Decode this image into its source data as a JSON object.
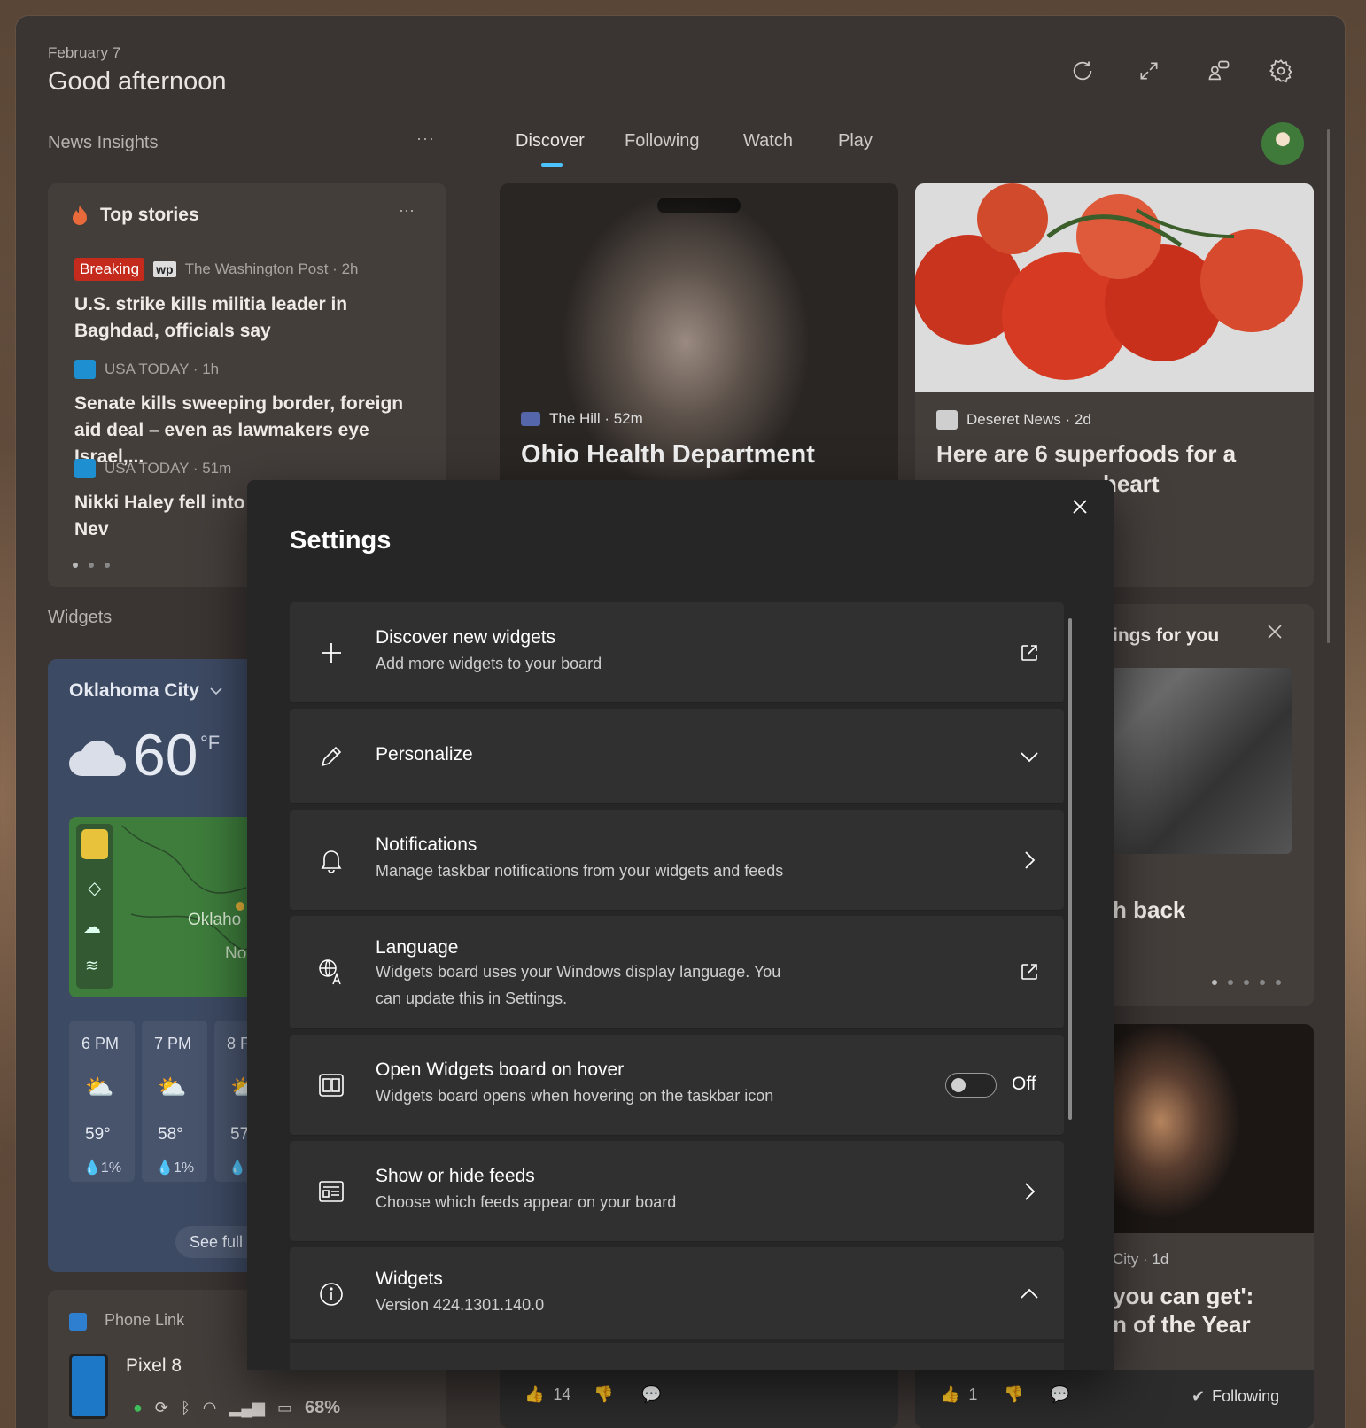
{
  "header": {
    "date": "February 7",
    "greeting": "Good afternoon"
  },
  "left": {
    "section_title": "News Insights",
    "more": "···",
    "widgets_title": "Widgets"
  },
  "tabs": [
    {
      "label": "Discover",
      "active": true
    },
    {
      "label": "Following",
      "active": false
    },
    {
      "label": "Watch",
      "active": false
    },
    {
      "label": "Play",
      "active": false
    }
  ],
  "top_stories": {
    "title": "Top stories",
    "more": "···",
    "items": [
      {
        "badge": "Breaking",
        "logo": "wp",
        "source": "The Washington Post · 2h",
        "title": "U.S. strike kills militia leader in Baghdad, officials say"
      },
      {
        "source": "USA TODAY · 1h",
        "title": "Senate kills sweeping border, foreign aid deal – even as lawmakers eye Israel,..."
      },
      {
        "source": "USA TODAY · 51m",
        "title": "Nikki Haley fell into a Trump's allies in Nev"
      }
    ]
  },
  "feed_cards": {
    "hill": {
      "source": "The Hill · 52m",
      "title": "Ohio Health Department"
    },
    "deseret": {
      "source": "Deseret News · 2d",
      "title": "Here are 6 superfoods for a",
      "title2": "heart"
    },
    "rec": {
      "title": "ings for you",
      "headline": "h back"
    },
    "city": {
      "source": "City · 1d",
      "title_line1": "you can get':",
      "title_line2": "n of the Year",
      "following": "Following"
    }
  },
  "reactions": {
    "card1_likes": "14",
    "card2_likes": "1"
  },
  "weather": {
    "location": "Oklahoma City",
    "temp": "60",
    "unit": "°F",
    "map_label": "Oklaho",
    "map_label2": "No",
    "see_full": "See full",
    "hours": [
      {
        "time": "6 PM",
        "temp": "59°",
        "precip": "1%"
      },
      {
        "time": "7 PM",
        "temp": "58°",
        "precip": "1%"
      },
      {
        "time": "8 P",
        "temp": "57",
        "precip": "1"
      }
    ]
  },
  "phone": {
    "app": "Phone Link",
    "device": "Pixel 8",
    "battery": "68%"
  },
  "settings": {
    "title": "Settings",
    "rows": {
      "discover": {
        "title": "Discover new widgets",
        "sub": "Add more widgets to your board"
      },
      "personalize": {
        "title": "Personalize"
      },
      "notifications": {
        "title": "Notifications",
        "sub": "Manage taskbar notifications from your widgets and feeds"
      },
      "language": {
        "title": "Language",
        "sub": "Widgets board uses your Windows display language. You can update this in Settings."
      },
      "hover": {
        "title": "Open Widgets board on hover",
        "sub": "Widgets board opens when hovering on the taskbar icon",
        "state": "Off"
      },
      "feeds": {
        "title": "Show or hide feeds",
        "sub": "Choose which feeds appear on your board"
      },
      "about": {
        "title": "Widgets",
        "sub": "Version 424.1301.140.0"
      }
    }
  },
  "colors": {
    "accent": "#4cc2ff",
    "breaking": "#c42b1c",
    "modal_bg": "#262626",
    "row_bg": "#303030"
  }
}
